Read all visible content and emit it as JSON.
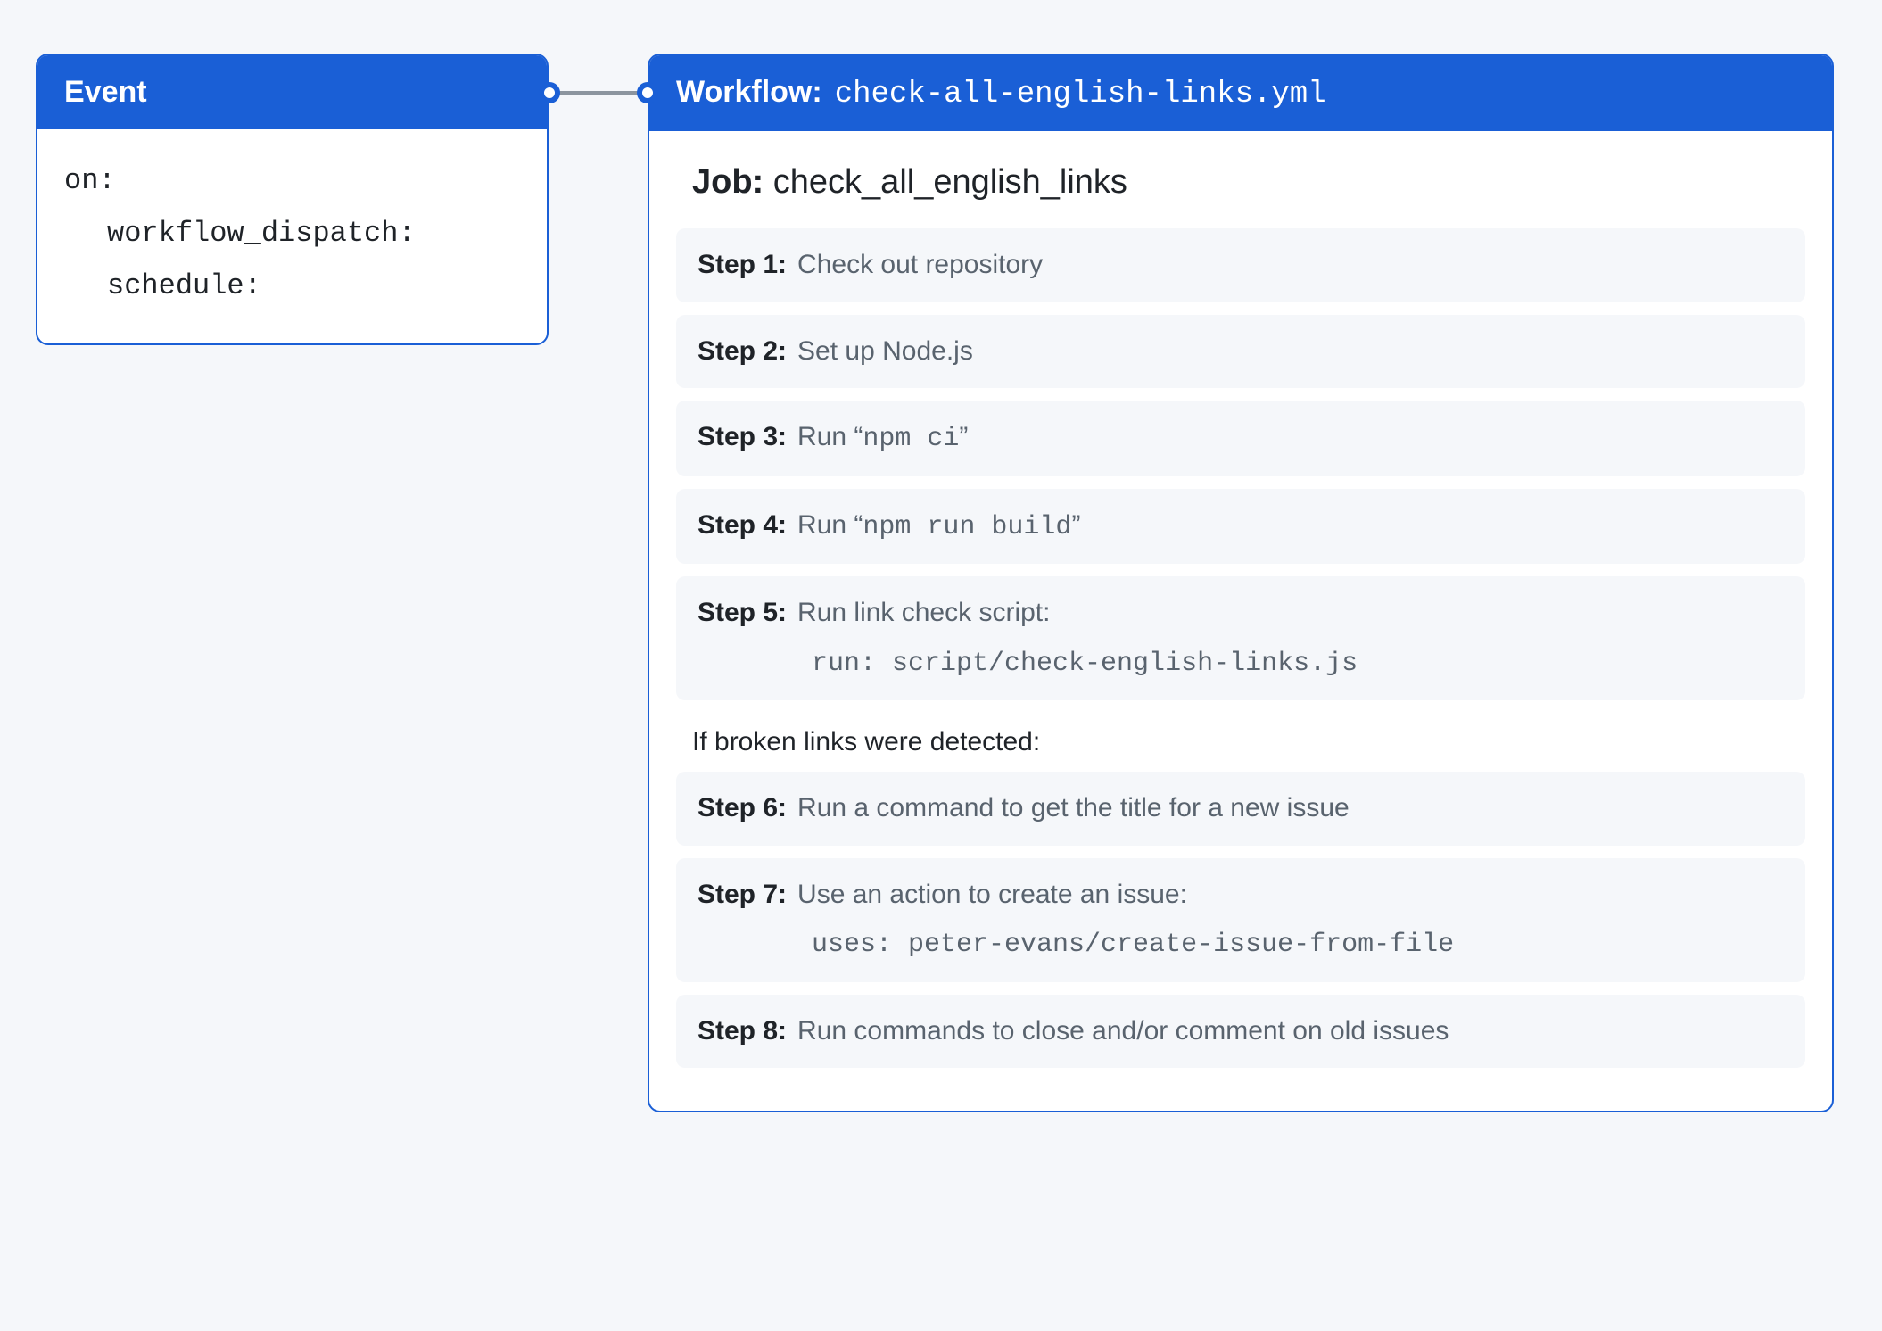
{
  "event": {
    "header_label": "Event",
    "lines": [
      {
        "text": "on:",
        "indent": false
      },
      {
        "text": "workflow_dispatch:",
        "indent": true
      },
      {
        "text": "schedule:",
        "indent": true
      }
    ]
  },
  "workflow": {
    "header_label": "Workflow:",
    "header_value": "check-all-english-links.yml",
    "job_label": "Job:",
    "job_name": "check_all_english_links",
    "steps_a": [
      {
        "label": "Step 1:",
        "desc_pre": "Check out repository",
        "mono": "",
        "desc_post": "",
        "detail": ""
      },
      {
        "label": "Step 2:",
        "desc_pre": "Set up Node.js",
        "mono": "",
        "desc_post": "",
        "detail": ""
      },
      {
        "label": "Step 3:",
        "desc_pre": "Run “",
        "mono": "npm ci",
        "desc_post": "”",
        "detail": ""
      },
      {
        "label": "Step 4:",
        "desc_pre": "Run “",
        "mono": "npm run build",
        "desc_post": "”",
        "detail": ""
      },
      {
        "label": "Step 5:",
        "desc_pre": "Run link check script:",
        "mono": "",
        "desc_post": "",
        "detail": "run: script/check-english-links.js"
      }
    ],
    "condition_text": "If broken links were detected:",
    "steps_b": [
      {
        "label": "Step 6:",
        "desc_pre": "Run a command to get the title for a new issue",
        "mono": "",
        "desc_post": "",
        "detail": ""
      },
      {
        "label": "Step 7:",
        "desc_pre": "Use an action to create an issue:",
        "mono": "",
        "desc_post": "",
        "detail": "uses: peter-evans/create-issue-from-file"
      },
      {
        "label": "Step 8:",
        "desc_pre": "Run commands to close and/or comment on old issues",
        "mono": "",
        "desc_post": "",
        "detail": ""
      }
    ]
  }
}
